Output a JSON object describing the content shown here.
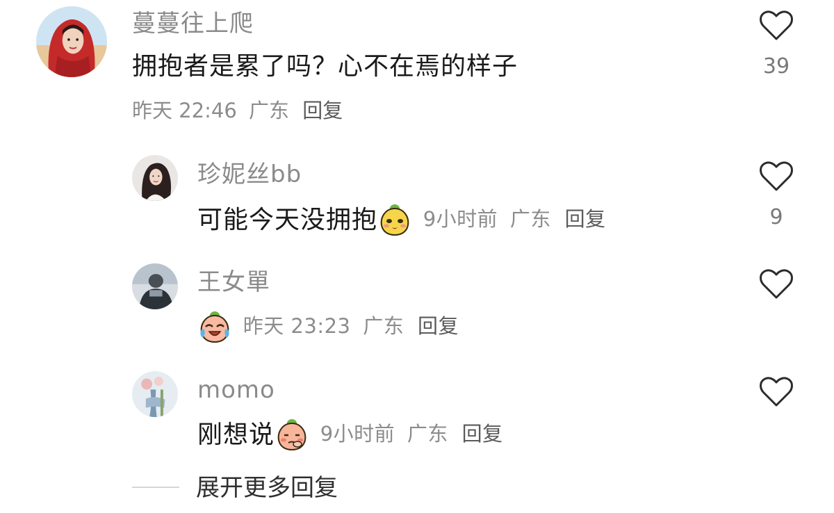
{
  "comments": [
    {
      "username": "蔓蔓往上爬",
      "text": "拥抱者是累了吗？心不在焉的样子",
      "time": "昨天 22:46",
      "location": "广东",
      "reply_label": "回复",
      "likes": "39",
      "avatar": "woman-red-scarf-avatar"
    }
  ],
  "replies": [
    {
      "username": "珍妮丝bb",
      "text": "可能今天没拥抱",
      "emoji": "yellow-peach-smirk-emoji",
      "time": "9小时前",
      "location": "广东",
      "reply_label": "回复",
      "likes": "9",
      "avatar": "woman-dark-hair-avatar"
    },
    {
      "username": "王女單",
      "text": "",
      "emoji": "peach-crying-laughing-emoji",
      "time": "昨天 23:23",
      "location": "广东",
      "reply_label": "回复",
      "likes": "",
      "avatar": "person-gray-avatar"
    },
    {
      "username": "momo",
      "text": "刚想说",
      "emoji": "peach-shy-emoji",
      "time": "9小时前",
      "location": "广东",
      "reply_label": "回复",
      "likes": "",
      "avatar": "flowers-avatar"
    }
  ],
  "expand_label": "展开更多回复",
  "colors": {
    "username": "#8a8a8a",
    "meta": "#8c8c8c",
    "text": "#1a1a1a",
    "like_outline": "#2b2b2b"
  }
}
